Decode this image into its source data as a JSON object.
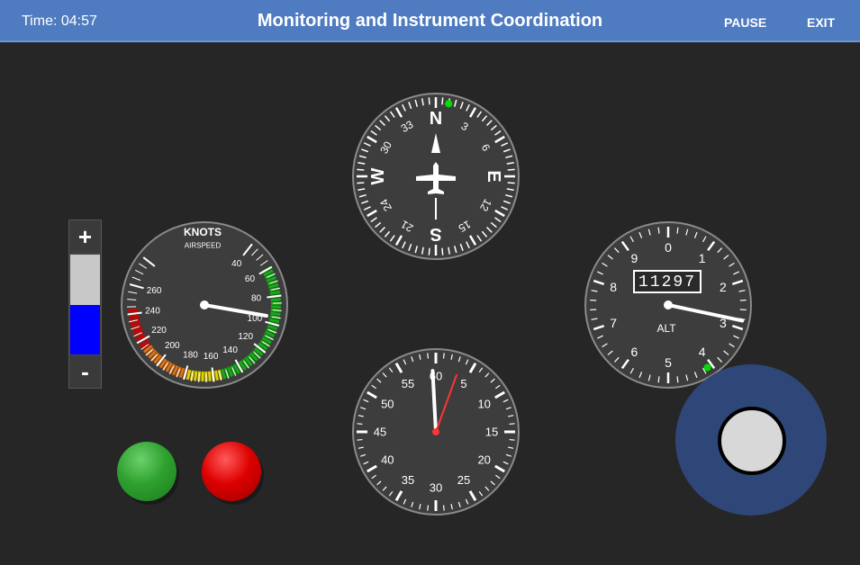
{
  "header": {
    "timer": "Time: 04:57",
    "title": "Monitoring and Instrument Coordination",
    "pause_label": "PAUSE",
    "exit_label": "EXIT"
  },
  "airspeed": {
    "title": "KNOTS",
    "subtitle": "AIRSPEED",
    "labels": [
      "40",
      "60",
      "80",
      "100",
      "120",
      "140",
      "160",
      "180",
      "200",
      "220",
      "240",
      "260"
    ],
    "needle_value": 95
  },
  "heading": {
    "labels": [
      "N",
      "3",
      "6",
      "E",
      "12",
      "15",
      "S",
      "21",
      "24",
      "W",
      "30",
      "33"
    ],
    "heading_deg": 0,
    "bug_deg": 10
  },
  "altimeter": {
    "labels": [
      "0",
      "1",
      "2",
      "3",
      "4",
      "5",
      "6",
      "7",
      "8",
      "9"
    ],
    "readout": "11297",
    "label": "ALT",
    "needle_value": 3
  },
  "clock": {
    "labels": [
      "60",
      "5",
      "10",
      "15",
      "20",
      "25",
      "30",
      "35",
      "40",
      "45",
      "50",
      "55"
    ]
  },
  "throttle": {
    "plus_label": "+",
    "minus_label": "-",
    "level": 0.5
  },
  "colors": {
    "topbar": "#4f7bc1",
    "background": "#262626",
    "gauge_face": "#3d3d3d",
    "green_button": "#2fa12f",
    "red_button": "#dd0000",
    "joystick_base": "#2f4778",
    "throttle_fill": "#0000ff"
  }
}
